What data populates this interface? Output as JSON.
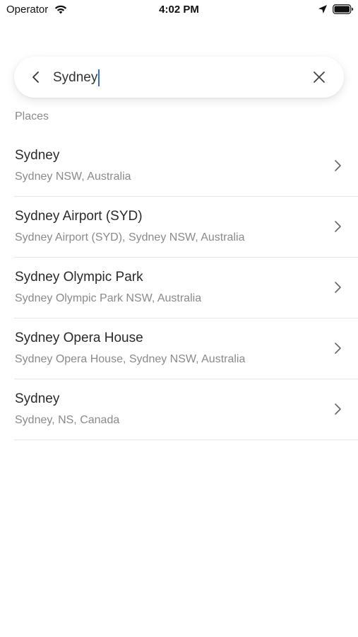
{
  "status_bar": {
    "carrier": "Operator",
    "time": "4:02 PM",
    "icons": [
      "wifi-icon",
      "location-arrow-icon",
      "battery-icon"
    ]
  },
  "search": {
    "value": "Sydney",
    "back_icon": "chevron-left-icon",
    "clear_icon": "close-icon",
    "caret_color": "#2f6ee8"
  },
  "section": {
    "label": "Places"
  },
  "results": [
    {
      "title": "Sydney",
      "subtitle": "Sydney NSW, Australia"
    },
    {
      "title": "Sydney Airport (SYD)",
      "subtitle": "Sydney Airport (SYD), Sydney NSW, Australia"
    },
    {
      "title": "Sydney Olympic Park",
      "subtitle": "Sydney Olympic Park NSW, Australia"
    },
    {
      "title": "Sydney Opera House",
      "subtitle": "Sydney Opera House, Sydney NSW, Australia"
    },
    {
      "title": "Sydney",
      "subtitle": "Sydney, NS, Canada"
    }
  ]
}
